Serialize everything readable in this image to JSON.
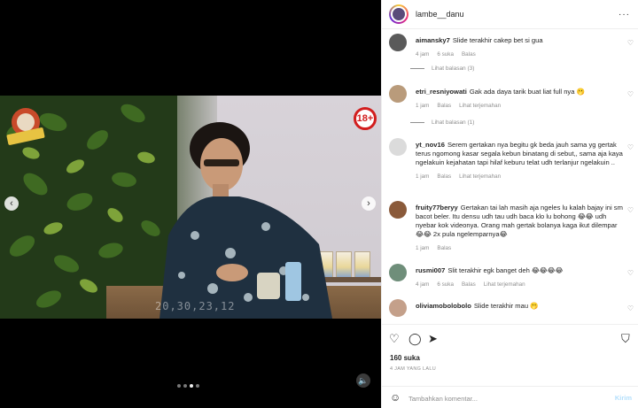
{
  "post": {
    "username": "lambe__danu",
    "likes": "160 suka",
    "time_ago": "4 JAM YANG LALU",
    "comment_placeholder": "Tambahkan komentar...",
    "post_label": "Kirim",
    "more_label": "···"
  },
  "media": {
    "timestamp_overlay": "20,30,23,12",
    "badge": "18+",
    "carousel_dots": 4,
    "active_dot": 2
  },
  "comments": [
    {
      "username": "aimansky7",
      "text": "Slide terakhir cakep bet si gua",
      "time": "4 jam",
      "likes": "6 suka",
      "reply": "Balas",
      "translate": "",
      "replies": "Lihat balasan (3)",
      "avatar_color": "#5a5a5a"
    },
    {
      "username": "etri_resniyowati",
      "text": "Gak ada daya tarik buat liat full nya 🫢",
      "time": "1 jam",
      "likes": "",
      "reply": "Balas",
      "translate": "Lihat terjemahan",
      "replies": "Lihat balasan (1)",
      "avatar_color": "#b99b7b"
    },
    {
      "username": "yt_nov16",
      "text": "Serem gertakan nya begitu gk beda jauh sama yg gertak terus ngomong kasar segala kebun binatang di sebut,, sama aja kaya ngelakuin kejahatan tapi hilaf keburu telat udh terlanjur ngelakuin ..",
      "time": "1 jam",
      "likes": "",
      "reply": "Balas",
      "translate": "Lihat terjemahan",
      "replies": "",
      "avatar_color": "#dbdbdb"
    },
    {
      "username": "fruity77beryy",
      "text": "Gertakan tai lah masih aja ngeles lu kalah bajay ini sm bacot beler. Itu densu udh tau udh baca klo lu bohong 😂😂 udh nyebar kok videonya. Orang mah gertak bolanya kaga ikut dilempar 😂😂 2x pula ngelemparnya😂",
      "time": "1 jam",
      "likes": "",
      "reply": "Balas",
      "translate": "",
      "replies": "",
      "avatar_color": "#8a5a3a"
    },
    {
      "username": "rusmi007",
      "text": "Slit terakhir egk banget deh 😂😂😂😂",
      "time": "4 jam",
      "likes": "6 suka",
      "reply": "Balas",
      "translate": "Lihat terjemahan",
      "replies": "",
      "avatar_color": "#6f8e7a"
    },
    {
      "username": "oliviamobolobolo",
      "text": "Slide terakhir mau 🫢",
      "time": "",
      "likes": "",
      "reply": "",
      "translate": "",
      "replies": "",
      "avatar_color": "#c4a08a"
    }
  ],
  "colors": {
    "accent_link": "#b2dffc",
    "text": "#262626",
    "muted": "#8e8e8e"
  }
}
